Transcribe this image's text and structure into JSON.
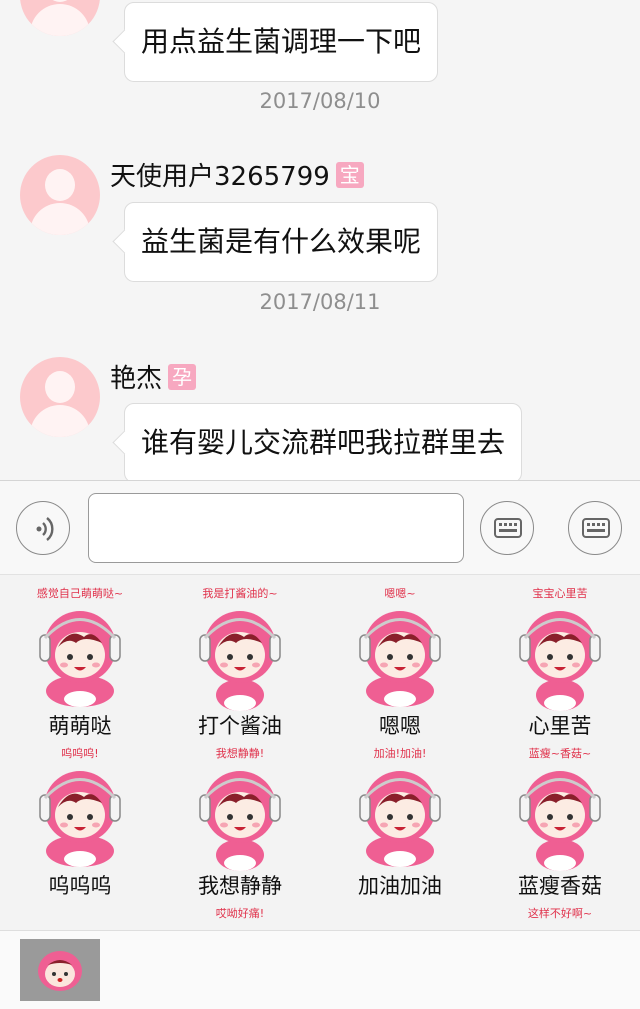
{
  "chat": {
    "messages": [
      {
        "username": "",
        "badge": "",
        "text": "用点益生菌调理一下吧"
      },
      {
        "username": "天使用户3265799",
        "badge": "宝",
        "text": "益生菌是有什么效果呢"
      },
      {
        "username": "艳杰",
        "badge": "孕",
        "text": "谁有婴儿交流群吧我拉群里去"
      }
    ],
    "dates": [
      "2017/08/10",
      "2017/08/11"
    ]
  },
  "input": {
    "value": "",
    "voice_icon": "voice-icon",
    "keyboard_icon": "keyboard-icon"
  },
  "stickers": [
    {
      "caption": "感觉自己萌萌哒~",
      "label": "萌萌哒"
    },
    {
      "caption": "我是打酱油的~",
      "label": "打个酱油"
    },
    {
      "caption": "嗯嗯~",
      "label": "嗯嗯"
    },
    {
      "caption": "宝宝心里苦",
      "label": "心里苦"
    },
    {
      "caption": "呜呜呜!",
      "label": "呜呜呜"
    },
    {
      "caption": "我想静静!",
      "label": "我想静静"
    },
    {
      "caption": "加油!加油!",
      "label": "加油加油"
    },
    {
      "caption": "蓝瘦~香菇~",
      "label": "蓝瘦香菇"
    },
    {
      "caption": "",
      "label": ""
    },
    {
      "caption": "哎呦好痛!",
      "label": ""
    },
    {
      "caption": "",
      "label": ""
    },
    {
      "caption": "这样不好啊~",
      "label": ""
    }
  ],
  "colors": {
    "mascot_pink": "#ef5f93",
    "mascot_dark": "#d2417a",
    "caption_red": "#e0304a",
    "avatar_pink": "#fcc9cc",
    "badge_pink": "#f7a8c0"
  }
}
